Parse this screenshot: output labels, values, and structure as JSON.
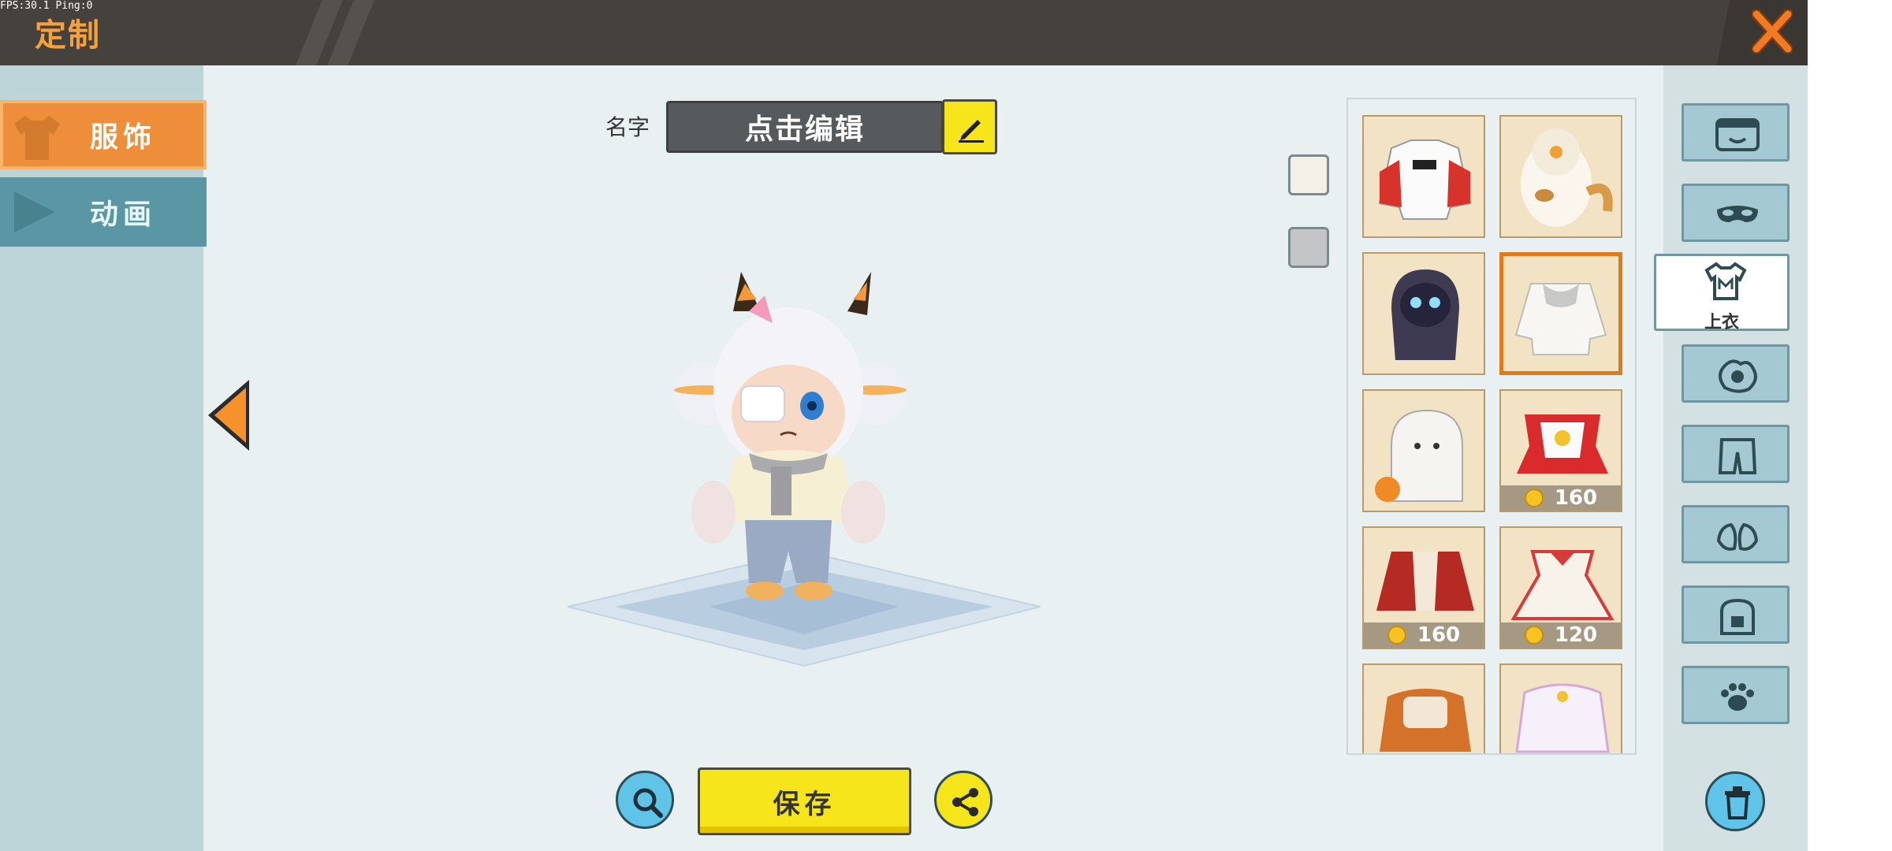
{
  "status_overlay": "FPS:30.1 Ping:0",
  "header": {
    "title": "定制"
  },
  "left_tabs": [
    {
      "label": "服饰",
      "active": true
    },
    {
      "label": "动画",
      "active": false
    }
  ],
  "editor": {
    "name_label": "名字",
    "name_placeholder": "点击编辑",
    "save_label": "保存"
  },
  "items": [
    {
      "name": "jacket",
      "price": null
    },
    {
      "name": "cat-costume",
      "price": null
    },
    {
      "name": "hooded-ghost",
      "price": null
    },
    {
      "name": "knit-sweater",
      "price": null,
      "selected": true
    },
    {
      "name": "ghost-costume",
      "price": null
    },
    {
      "name": "red-festival-outfit",
      "price": "160"
    },
    {
      "name": "red-robe",
      "price": "160"
    },
    {
      "name": "red-white-dress",
      "price": "120"
    },
    {
      "name": "orange-outfit",
      "price": null
    },
    {
      "name": "white-lace-dress",
      "price": null
    }
  ],
  "categories": [
    {
      "icon": "face-icon"
    },
    {
      "icon": "mask-icon"
    },
    {
      "icon": "shirt-icon",
      "label": "上衣",
      "active": true
    },
    {
      "icon": "gloves-icon"
    },
    {
      "icon": "pants-icon"
    },
    {
      "icon": "shoes-icon"
    },
    {
      "icon": "backpack-icon"
    },
    {
      "icon": "pet-icon"
    }
  ],
  "colors": {
    "accent_orange": "#ef8e3a",
    "button_yellow": "#f5e51a",
    "topbar": "#45423e",
    "cyan_button": "#5fc4e8"
  }
}
